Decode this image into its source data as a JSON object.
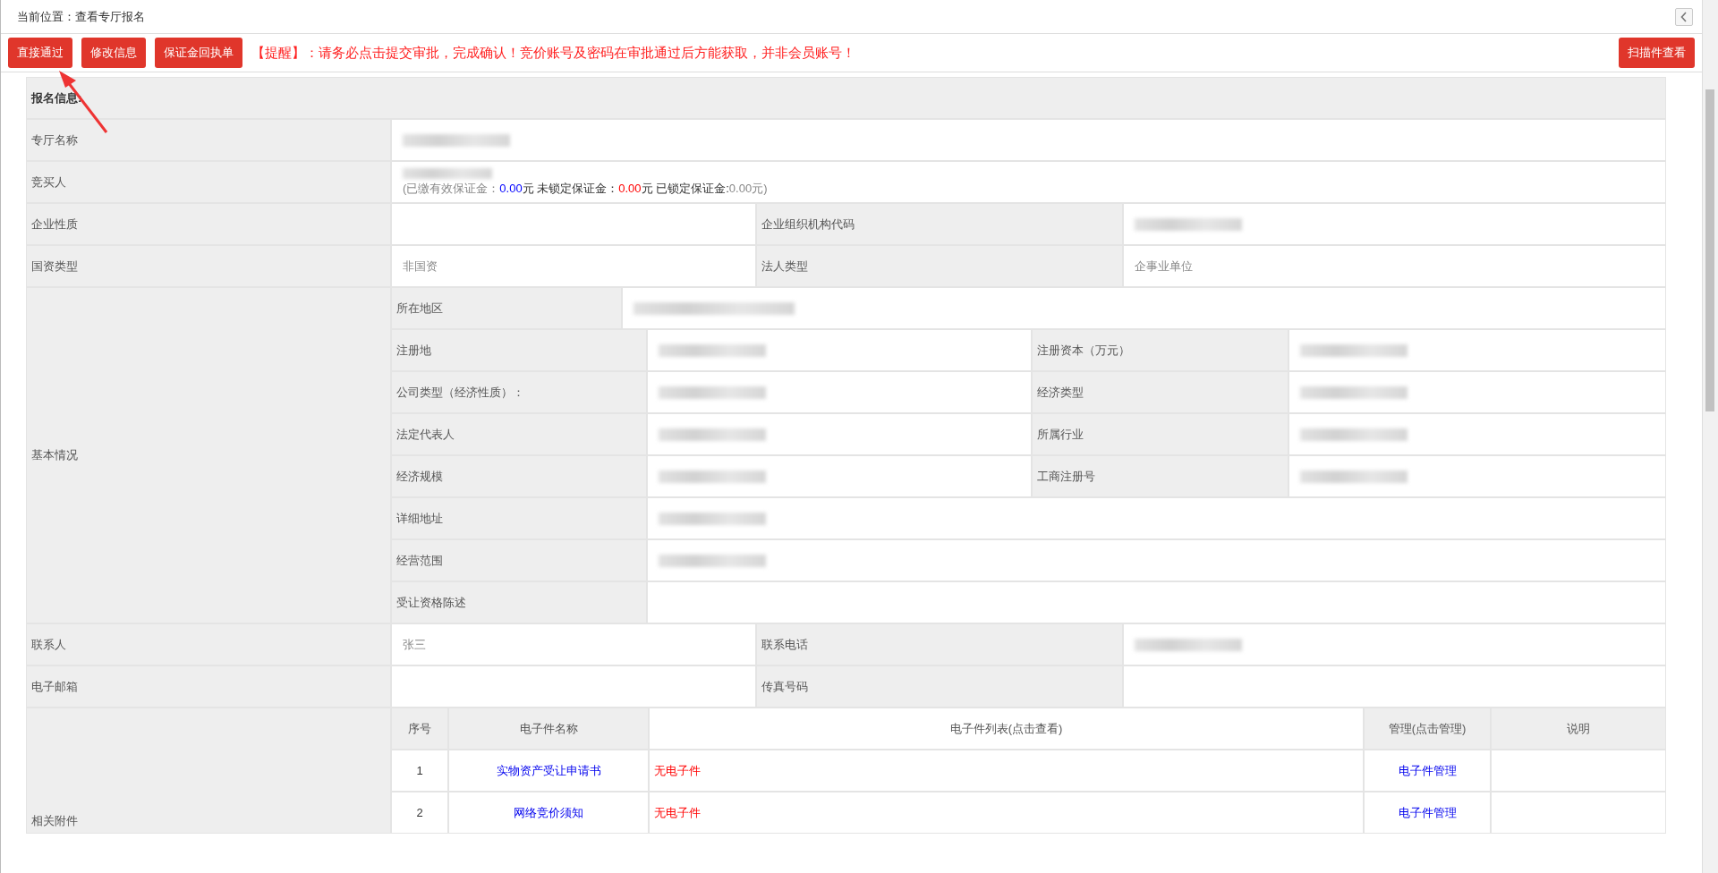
{
  "breadcrumb": "当前位置：查看专厅报名",
  "toolbar": {
    "buttons": [
      "直接通过",
      "修改信息",
      "保证金回执单"
    ],
    "notice": "【提醒】：请务必点击提交审批，完成确认！竞价账号及密码在审批通过后方能获取，并非会员账号！",
    "right_button": "扫描件查看"
  },
  "form": {
    "section_title": "报名信息:",
    "rows": [
      {
        "kind": "single",
        "label": "专厅名称",
        "blurred": true
      },
      {
        "kind": "bidder",
        "label": "竞买人",
        "blurred": true,
        "deposit": [
          {
            "text": "(已缴有效保证金：",
            "color": "#888888"
          },
          {
            "text": "0.00",
            "color": "#0000ff"
          },
          {
            "text": "元 未锁定保证金：",
            "color": "#333333"
          },
          {
            "text": "0.00",
            "color": "#ff0000"
          },
          {
            "text": "元 已锁定保证金:",
            "color": "#333333"
          },
          {
            "text": "0.00元)",
            "color": "#888888"
          }
        ]
      },
      {
        "kind": "double",
        "cells": [
          {
            "label": "企业性质",
            "blurred": false
          },
          {
            "label": "企业组织机构代码",
            "blurred": true
          }
        ]
      },
      {
        "kind": "double",
        "cells": [
          {
            "label": "国资类型",
            "value": "非国资",
            "blurred": false
          },
          {
            "label": "法人类型",
            "value": "企事业单位",
            "blurred": false
          }
        ]
      },
      {
        "kind": "group",
        "label": "基本情况",
        "rows": [
          {
            "kind": "region",
            "label": "所在地区",
            "blurred": true
          },
          {
            "kind": "double",
            "cells": [
              {
                "label": "注册地",
                "blurred": true
              },
              {
                "label": "注册资本（万元）",
                "blurred": true
              }
            ]
          },
          {
            "kind": "double",
            "cells": [
              {
                "label": "公司类型（经济性质）：",
                "blurred": true
              },
              {
                "label": "经济类型",
                "blurred": true
              }
            ]
          },
          {
            "kind": "double",
            "cells": [
              {
                "label": "法定代表人",
                "blurred": true
              },
              {
                "label": "所属行业",
                "blurred": true
              }
            ]
          },
          {
            "kind": "double",
            "cells": [
              {
                "label": "经济规模",
                "blurred": true
              },
              {
                "label": "工商注册号",
                "blurred": true
              }
            ]
          },
          {
            "kind": "single",
            "label": "详细地址",
            "blurred": true
          },
          {
            "kind": "single",
            "label": "经营范围",
            "blurred": true
          },
          {
            "kind": "single",
            "label": "受让资格陈述",
            "blurred": false
          }
        ]
      },
      {
        "kind": "double",
        "cells": [
          {
            "label": "联系人",
            "value": "张三",
            "blurred": false
          },
          {
            "label": "联系电话",
            "blurred": true
          }
        ]
      },
      {
        "kind": "double",
        "cells": [
          {
            "label": "电子邮箱",
            "blurred": false
          },
          {
            "label": "传真号码",
            "blurred": false
          }
        ]
      },
      {
        "kind": "attachments",
        "label": "相关附件",
        "columns": [
          "序号",
          "电子件名称",
          "电子件列表(点击查看)",
          "管理(点击管理)",
          "说明"
        ],
        "rows": [
          {
            "index": "1",
            "name": "实物资产受让申请书",
            "files": "无电子件",
            "manage": "电子件管理"
          },
          {
            "index": "2",
            "name": "网络竞价须知",
            "files": "无电子件",
            "manage": "电子件管理"
          }
        ]
      }
    ]
  }
}
